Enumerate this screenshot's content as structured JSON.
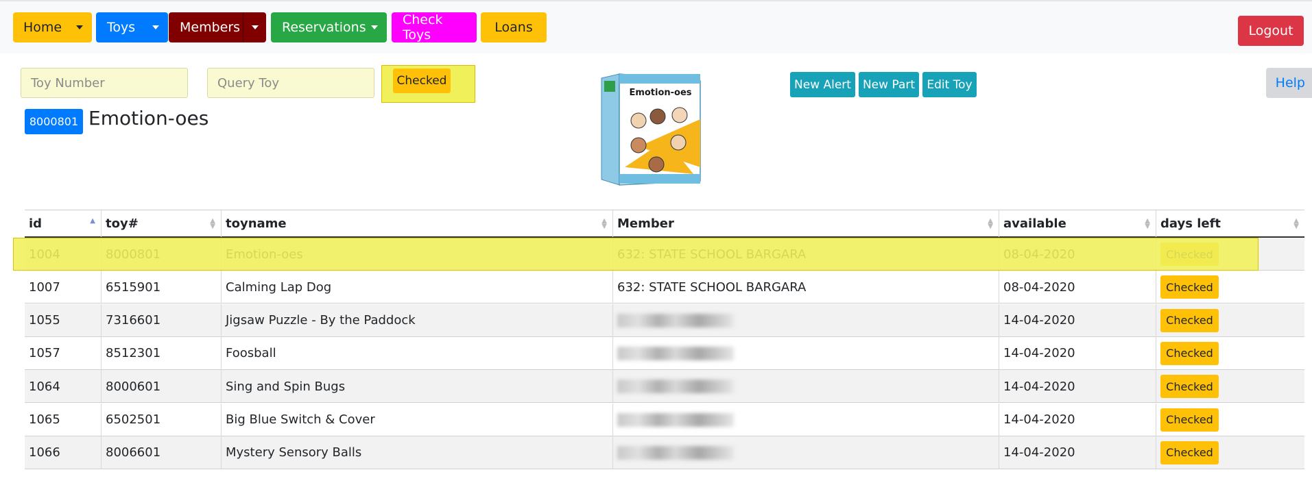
{
  "nav": {
    "home": "Home",
    "toys": "Toys",
    "members": "Members",
    "reservations": "Reservations",
    "check_toys": "Check Toys",
    "loans": "Loans",
    "logout": "Logout"
  },
  "colors": {
    "home": "#ffc107",
    "toys": "#007bff",
    "members": "#800000",
    "reservations": "#28a745",
    "check_toys": "#ff00ff",
    "loans": "#ffc107",
    "logout": "#dc3545",
    "teal": "#17a2b8",
    "highlight": "#f0f05a"
  },
  "search": {
    "toy_number_placeholder": "Toy Number",
    "query_placeholder": "Query Toy",
    "status_button": "Checked"
  },
  "toy": {
    "number": "8000801",
    "name": "Emotion-oes",
    "box_label": "Emotion-oes"
  },
  "actions": {
    "new_alert": "New Alert",
    "new_part": "New Part",
    "edit_toy": "Edit Toy",
    "help": "Help"
  },
  "table": {
    "columns": [
      "id",
      "toy#",
      "toyname",
      "Member",
      "available",
      "days left"
    ],
    "rows": [
      {
        "id": "1004",
        "toy": "8000801",
        "name": "Emotion-oes",
        "member": "632: STATE SCHOOL BARGARA",
        "available": "08-04-2020",
        "status": "Checked"
      },
      {
        "id": "1007",
        "toy": "6515901",
        "name": "Calming Lap Dog",
        "member": "632: STATE SCHOOL BARGARA",
        "available": "08-04-2020",
        "status": "Checked"
      },
      {
        "id": "1055",
        "toy": "7316601",
        "name": "Jigsaw Puzzle - By the Paddock",
        "member": "",
        "available": "14-04-2020",
        "status": "Checked"
      },
      {
        "id": "1057",
        "toy": "8512301",
        "name": "Foosball",
        "member": "",
        "available": "14-04-2020",
        "status": "Checked"
      },
      {
        "id": "1064",
        "toy": "8000601",
        "name": "Sing and Spin Bugs",
        "member": "",
        "available": "14-04-2020",
        "status": "Checked"
      },
      {
        "id": "1065",
        "toy": "6502501",
        "name": "Big Blue Switch & Cover",
        "member": "",
        "available": "14-04-2020",
        "status": "Checked"
      },
      {
        "id": "1066",
        "toy": "8006601",
        "name": "Mystery Sensory Balls",
        "member": "",
        "available": "14-04-2020",
        "status": "Checked"
      }
    ]
  }
}
